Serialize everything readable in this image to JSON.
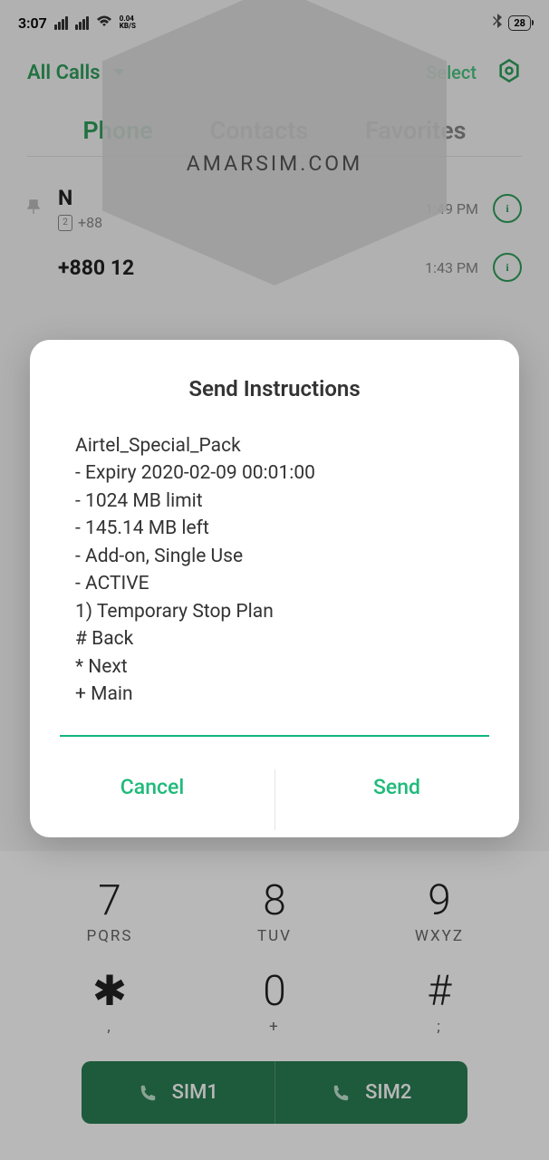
{
  "status": {
    "time": "3:07",
    "kbs_top": "0.04",
    "kbs_bottom": "KB/S",
    "battery": "28"
  },
  "header": {
    "filter": "All Calls",
    "select": "Select"
  },
  "tabs": {
    "phone": "Phone",
    "contacts": "Contacts",
    "favorites": "Favorites"
  },
  "watermark": "AMARSIM.COM",
  "calls": [
    {
      "number": "N",
      "sim_prefix": "+88",
      "sub2": "+88",
      "time": "1:49 PM"
    },
    {
      "number": "+880 12",
      "time": "1:43 PM"
    }
  ],
  "dial": {
    "k7": "7",
    "k7s": "PQRS",
    "k8": "8",
    "k8s": "TUV",
    "k9": "9",
    "k9s": "WXYZ",
    "kstar": "✱",
    "kstars": ",",
    "k0": "0",
    "k0s": "+",
    "khash": "#",
    "khashs": ";"
  },
  "sim": {
    "sim1": "SIM1",
    "sim2": "SIM2"
  },
  "dialog": {
    "title": "Send Instructions",
    "line0": "Airtel_Special_Pack",
    "line1": "- Expiry 2020-02-09 00:01:00",
    "line2": "- 1024 MB limit",
    "line3": "- 145.14 MB left",
    "line4": "- Add-on, Single Use",
    "line5": "- ACTIVE",
    "line6": "1) Temporary Stop Plan",
    "line7": "# Back",
    "line8": "* Next",
    "line9": "+ Main",
    "cancel": "Cancel",
    "send": "Send"
  }
}
